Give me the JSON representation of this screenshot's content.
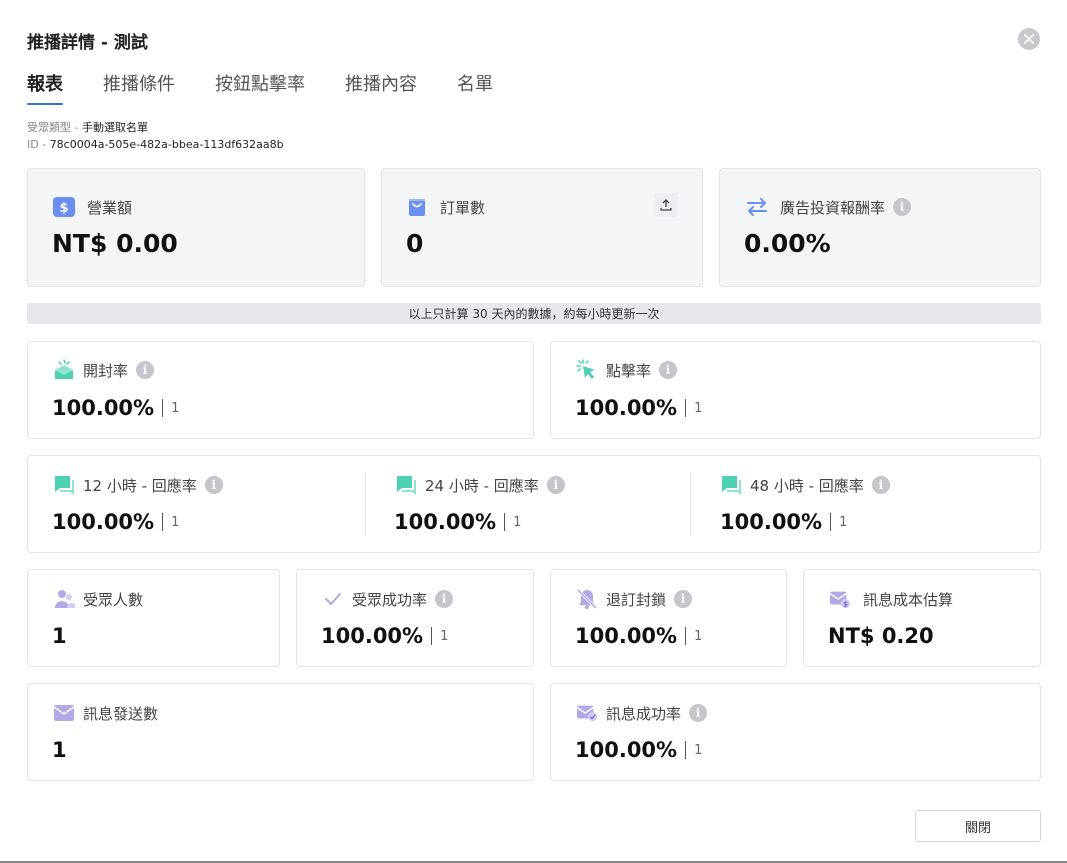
{
  "dialog": {
    "title": "推播詳情 - 測試"
  },
  "tabs": [
    {
      "label": "報表",
      "active": true
    },
    {
      "label": "推播條件",
      "active": false
    },
    {
      "label": "按鈕點擊率",
      "active": false
    },
    {
      "label": "推播內容",
      "active": false
    },
    {
      "label": "名單",
      "active": false
    }
  ],
  "meta": {
    "audience_type_label": "受眾類型 - ",
    "audience_type_value": "手動選取名單",
    "id_label": "ID - ",
    "id_value": "78c0004a-505e-482a-bbea-113df632aa8b"
  },
  "top_cards": {
    "revenue": {
      "label": "營業額",
      "value": "NT$ 0.00"
    },
    "orders": {
      "label": "訂單數",
      "value": "0"
    },
    "roas": {
      "label": "廣告投資報酬率",
      "value": "0.00%"
    }
  },
  "notice": "以上只計算 30 天內的數據，約每小時更新一次",
  "open_rate": {
    "label": "開封率",
    "value": "100.00%",
    "count": "1"
  },
  "click_rate": {
    "label": "點擊率",
    "value": "100.00%",
    "count": "1"
  },
  "reply": {
    "h12": {
      "label": "12 小時 - 回應率",
      "value": "100.00%",
      "count": "1"
    },
    "h24": {
      "label": "24 小時 - 回應率",
      "value": "100.00%",
      "count": "1"
    },
    "h48": {
      "label": "48 小時 - 回應率",
      "value": "100.00%",
      "count": "1"
    }
  },
  "audience_count": {
    "label": "受眾人數",
    "value": "1"
  },
  "audience_success": {
    "label": "受眾成功率",
    "value": "100.00%",
    "count": "1"
  },
  "unsubscribe": {
    "label": "退訂封鎖",
    "value": "100.00%",
    "count": "1"
  },
  "cost_estimate": {
    "label": "訊息成本估算",
    "value": "NT$ 0.20"
  },
  "messages_sent": {
    "label": "訊息發送數",
    "value": "1"
  },
  "message_success": {
    "label": "訊息成功率",
    "value": "100.00%",
    "count": "1"
  },
  "footer": {
    "close_label": "關閉"
  },
  "icons": {
    "close": "close-circle-icon",
    "revenue": "dollar-icon",
    "orders": "shopping-bag-icon",
    "roas": "exchange-arrows-icon",
    "info": "info-icon",
    "export": "upload-icon",
    "open": "open-envelope-icon",
    "click": "cursor-click-icon",
    "chat": "chat-bubble-icon",
    "users": "users-icon",
    "check": "check-icon",
    "bell_off": "bell-off-icon",
    "mail_cost": "mail-dollar-icon",
    "mail": "mail-icon",
    "mail_check": "mail-check-icon"
  },
  "colors": {
    "accent_blue": "#3b6fd8",
    "icon_blue": "#6b8ff0",
    "icon_teal": "#4fd1b5",
    "icon_purple": "#b3a8e8"
  }
}
